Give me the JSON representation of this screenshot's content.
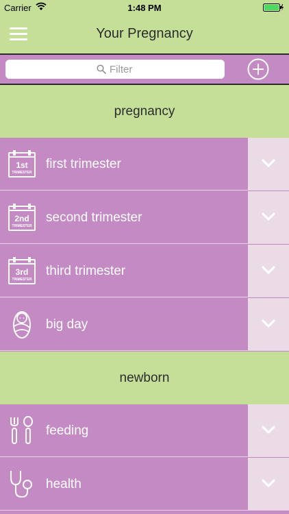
{
  "status_bar": {
    "carrier": "Carrier",
    "time": "1:48 PM"
  },
  "nav": {
    "title": "Your Pregnancy",
    "menu_icon": "hamburger-menu-icon"
  },
  "search": {
    "placeholder": "Filter",
    "add_icon": "plus-circle-icon"
  },
  "sections": [
    {
      "title": "pregnancy",
      "items": [
        {
          "label": "first trimester",
          "icon": "calendar-1st-trimester-icon",
          "badge_top": "1st",
          "badge_bottom": "TRIMESTER"
        },
        {
          "label": "second trimester",
          "icon": "calendar-2nd-trimester-icon",
          "badge_top": "2nd",
          "badge_bottom": "TRIMESTER"
        },
        {
          "label": "third trimester",
          "icon": "calendar-3rd-trimester-icon",
          "badge_top": "3rd",
          "badge_bottom": "TRIMESTER"
        },
        {
          "label": "big day",
          "icon": "swaddled-baby-icon"
        }
      ]
    },
    {
      "title": "newborn",
      "items": [
        {
          "label": "feeding",
          "icon": "fork-spoon-icon"
        },
        {
          "label": "health",
          "icon": "stethoscope-icon"
        }
      ]
    }
  ],
  "colors": {
    "green": "#c5df99",
    "purple": "#c48ac4",
    "expand_bg": "#ebdbe6"
  }
}
